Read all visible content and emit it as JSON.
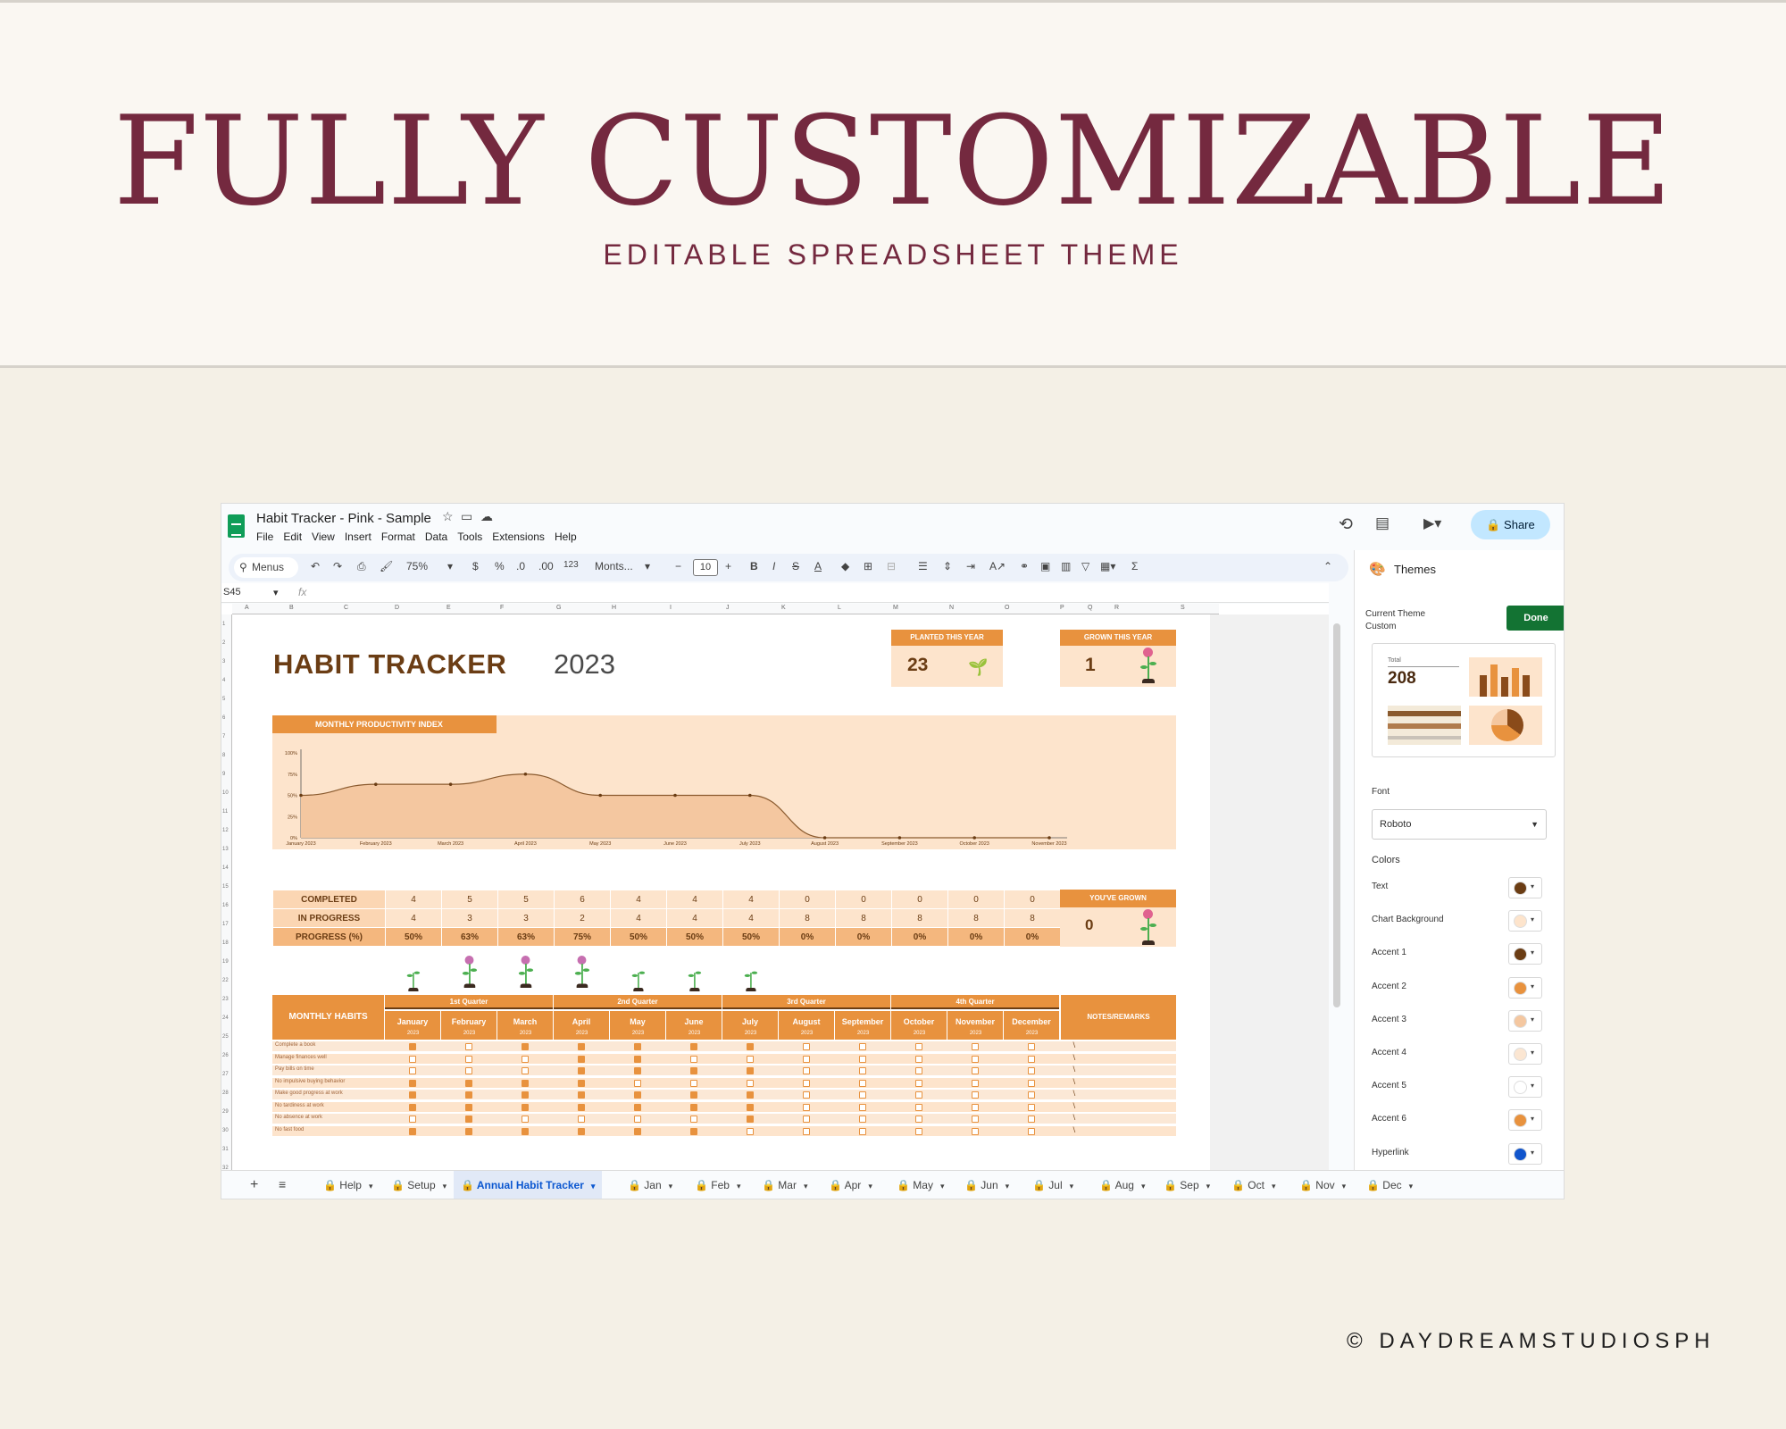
{
  "hero": {
    "title": "FULLY CUSTOMIZABLE",
    "subtitle": "EDITABLE SPREADSHEET THEME"
  },
  "credit": "© DAYDREAMSTUDIOSPH",
  "app": {
    "doc_title": "Habit Tracker - Pink - Sample",
    "menus": [
      "File",
      "Edit",
      "View",
      "Insert",
      "Format",
      "Data",
      "Tools",
      "Extensions",
      "Help"
    ],
    "share_label": "Share",
    "toolbar": {
      "search": "Menus",
      "zoom": "75%",
      "currency": "$",
      "percent": "%",
      "decimals_down": ".0",
      "decimals_up": ".00",
      "number_format": "123",
      "font": "Monts...",
      "font_size": "10"
    },
    "formula": {
      "name_box": "S45",
      "fx": "fx"
    },
    "columns": [
      "A",
      "B",
      "C",
      "D",
      "E",
      "F",
      "G",
      "H",
      "I",
      "J",
      "K",
      "L",
      "M",
      "N",
      "O",
      "P",
      "Q",
      "R",
      "S"
    ],
    "rows": [
      "1",
      "2",
      "3",
      "4",
      "5",
      "6",
      "7",
      "8",
      "9",
      "10",
      "11",
      "12",
      "13",
      "14",
      "15",
      "16",
      "17",
      "18",
      "19",
      "22",
      "23",
      "24",
      "25",
      "26",
      "27",
      "28",
      "29",
      "30",
      "31",
      "32"
    ]
  },
  "sheet": {
    "title": "HABIT TRACKER",
    "year": "2023",
    "planted": {
      "label": "PLANTED THIS YEAR",
      "value": "23"
    },
    "grown": {
      "label": "GROWN THIS YEAR",
      "value": "1"
    },
    "youve_grown": {
      "label": "YOU'VE GROWN",
      "value": "0"
    },
    "summary": {
      "rows": [
        {
          "label": "COMPLETED",
          "values": [
            "4",
            "5",
            "5",
            "6",
            "4",
            "4",
            "4",
            "0",
            "0",
            "0",
            "0",
            "0"
          ]
        },
        {
          "label": "IN PROGRESS",
          "values": [
            "4",
            "3",
            "3",
            "2",
            "4",
            "4",
            "4",
            "8",
            "8",
            "8",
            "8",
            "8"
          ]
        },
        {
          "label": "PROGRESS (%)",
          "values": [
            "50%",
            "63%",
            "63%",
            "75%",
            "50%",
            "50%",
            "50%",
            "0%",
            "0%",
            "0%",
            "0%",
            "0%"
          ]
        }
      ]
    },
    "habits": {
      "header": "MONTHLY HABITS",
      "notes_header": "NOTES/REMARKS",
      "quarters": [
        "1st Quarter",
        "2nd Quarter",
        "3rd Quarter",
        "4th Quarter"
      ],
      "months": [
        "January",
        "February",
        "March",
        "April",
        "May",
        "June",
        "July",
        "August",
        "September",
        "October",
        "November",
        "December"
      ],
      "year_sub": "2023",
      "rows": [
        {
          "name": "Complete a book",
          "checks": [
            1,
            0,
            1,
            1,
            1,
            1,
            1,
            0,
            0,
            0,
            0,
            0
          ]
        },
        {
          "name": "Manage finances well",
          "checks": [
            0,
            0,
            0,
            1,
            1,
            0,
            0,
            0,
            0,
            0,
            0,
            0
          ]
        },
        {
          "name": "Pay bills on time",
          "checks": [
            0,
            0,
            0,
            1,
            1,
            1,
            1,
            0,
            0,
            0,
            0,
            0
          ]
        },
        {
          "name": "No impulsive buying behavior",
          "checks": [
            1,
            1,
            1,
            1,
            0,
            0,
            0,
            0,
            0,
            0,
            0,
            0
          ]
        },
        {
          "name": "Make good progress at work",
          "checks": [
            1,
            1,
            1,
            1,
            1,
            1,
            1,
            0,
            0,
            0,
            0,
            0
          ]
        },
        {
          "name": "No tardiness at work",
          "checks": [
            1,
            1,
            1,
            1,
            1,
            1,
            1,
            0,
            0,
            0,
            0,
            0
          ]
        },
        {
          "name": "No absence at work",
          "checks": [
            0,
            1,
            0,
            0,
            0,
            0,
            1,
            0,
            0,
            0,
            0,
            0
          ]
        },
        {
          "name": "No fast food",
          "checks": [
            1,
            1,
            1,
            1,
            1,
            1,
            0,
            0,
            0,
            0,
            0,
            0
          ]
        }
      ]
    },
    "plants_grown": [
      1,
      2,
      2,
      2,
      1,
      1,
      1
    ]
  },
  "chart_data": {
    "type": "area",
    "title": "MONTHLY PRODUCTIVITY INDEX",
    "categories": [
      "January 2023",
      "February 2023",
      "March 2023",
      "April 2023",
      "May 2023",
      "June 2023",
      "July 2023",
      "August 2023",
      "September 2023",
      "October 2023",
      "November 2023"
    ],
    "values": [
      50,
      63,
      63,
      75,
      50,
      50,
      50,
      0,
      0,
      0,
      0
    ],
    "y_ticks": [
      "100%",
      "75%",
      "50%",
      "25%",
      "0%"
    ],
    "ylim": [
      0,
      100
    ],
    "fill_color": "#f4c7a0",
    "line_color": "#8a5a2e"
  },
  "themes": {
    "title": "Themes",
    "current_label": "Current Theme",
    "current_value": "Custom",
    "done_label": "Done",
    "preview_total_label": "Total",
    "preview_total_value": "208",
    "font_label": "Font",
    "font_value": "Roboto",
    "colors_label": "Colors",
    "colors": [
      {
        "label": "Text",
        "color": "#6b3d14"
      },
      {
        "label": "Chart Background",
        "color": "#fde4cc"
      },
      {
        "label": "Accent 1",
        "color": "#6b3d14"
      },
      {
        "label": "Accent 2",
        "color": "#e8923e"
      },
      {
        "label": "Accent 3",
        "color": "#f4c7a0"
      },
      {
        "label": "Accent 4",
        "color": "#fbe6d2"
      },
      {
        "label": "Accent 5",
        "color": "#ffffff"
      },
      {
        "label": "Accent 6",
        "color": "#e8923e"
      },
      {
        "label": "Hyperlink",
        "color": "#1155cc"
      }
    ]
  },
  "tabs": [
    {
      "label": "Help",
      "active": false
    },
    {
      "label": "Setup",
      "active": false
    },
    {
      "label": "Annual Habit Tracker",
      "active": true
    },
    {
      "label": "Jan",
      "active": false
    },
    {
      "label": "Feb",
      "active": false
    },
    {
      "label": "Mar",
      "active": false
    },
    {
      "label": "Apr",
      "active": false
    },
    {
      "label": "May",
      "active": false
    },
    {
      "label": "Jun",
      "active": false
    },
    {
      "label": "Jul",
      "active": false
    },
    {
      "label": "Aug",
      "active": false
    },
    {
      "label": "Sep",
      "active": false
    },
    {
      "label": "Oct",
      "active": false
    },
    {
      "label": "Nov",
      "active": false
    },
    {
      "label": "Dec",
      "active": false
    }
  ]
}
